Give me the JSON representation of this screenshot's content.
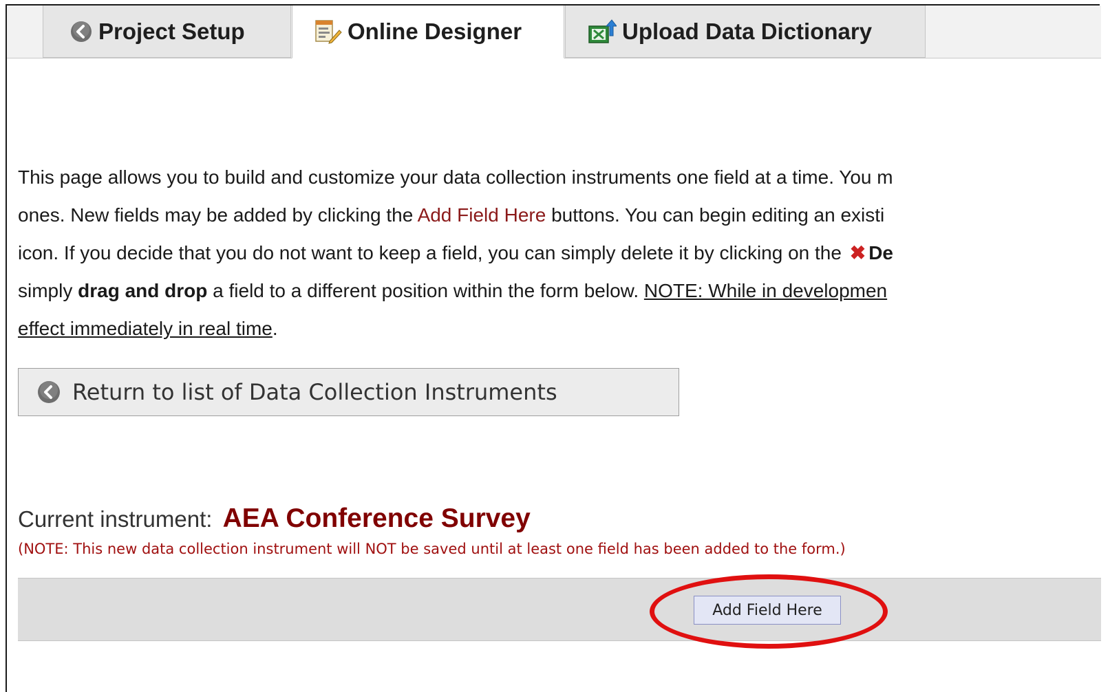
{
  "tabs": [
    {
      "label": "Project Setup",
      "icon": "back-arrow-icon",
      "active": false
    },
    {
      "label": "Online Designer",
      "icon": "form-edit-icon",
      "active": true
    },
    {
      "label": "Upload Data Dictionary",
      "icon": "excel-upload-icon",
      "active": false
    }
  ],
  "intro": {
    "line1": "This page allows you to build and customize your data collection instruments one field at a time. You m",
    "line2_pre": "ones. New fields may be added by clicking the ",
    "line2_link": "Add Field Here",
    "line2_post": " buttons. You can begin editing an existi",
    "line3_pre": "icon. If you decide that you do not want to keep a field, you can simply delete it by clicking on the ",
    "line3_bold": "De",
    "line4_pre": "simply ",
    "line4_bold": "drag and drop",
    "line4_mid": " a field to a different position within the form below. ",
    "line4_underline": "NOTE: While in developmen",
    "line5_underline": "effect immediately in real time",
    "line5_post": "."
  },
  "return_button": {
    "label": "Return to list of Data Collection Instruments",
    "icon": "back-arrow-icon"
  },
  "instrument": {
    "prefix": "Current instrument:",
    "name": "AEA Conference Survey",
    "note": "(NOTE: This new data collection instrument will NOT be saved until at least one field has been added to the form.)"
  },
  "add_field": {
    "label": "Add Field Here"
  },
  "colors": {
    "instrument_name": "#800000",
    "note_text": "#a01010",
    "link_red": "#8b1a1a",
    "highlight_ring": "#e01010",
    "add_bar_bg": "#dddddd"
  }
}
